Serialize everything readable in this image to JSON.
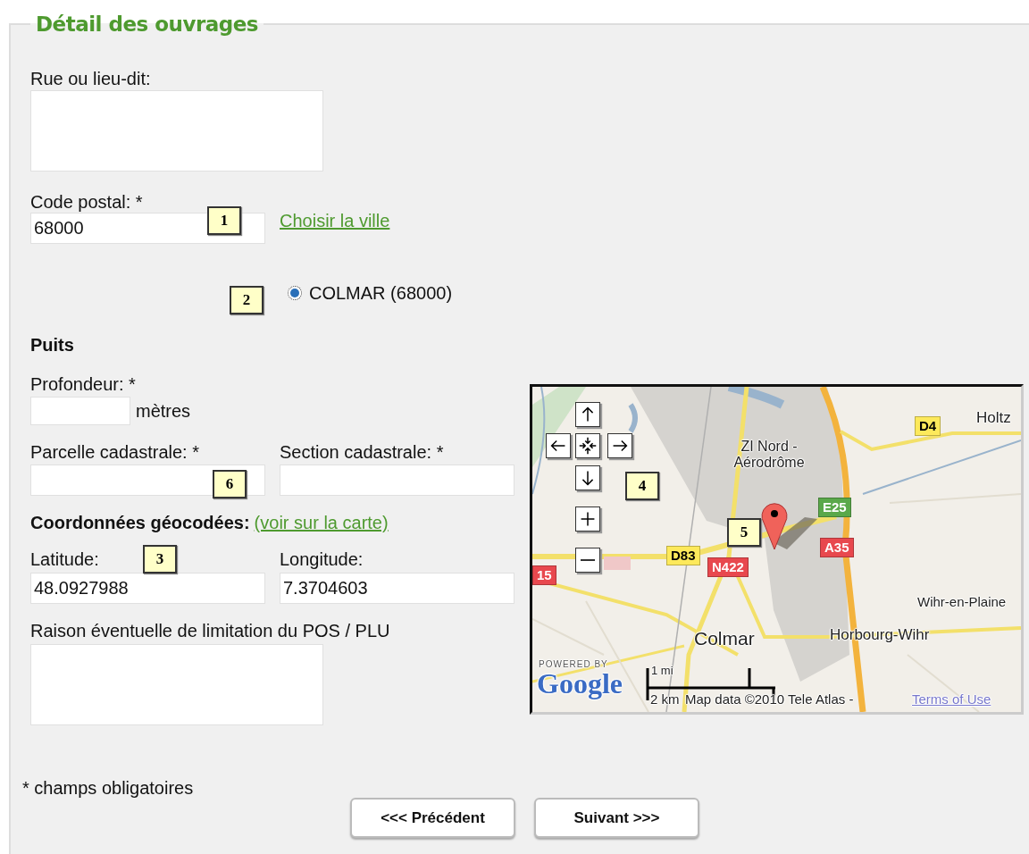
{
  "section": {
    "title": "Détail des ouvrages"
  },
  "street": {
    "label": "Rue ou lieu-dit:"
  },
  "postal": {
    "label": "Code postal: *",
    "value": "68000",
    "link": "Choisir la ville"
  },
  "cities": [
    {
      "label": "COLMAR (68000)",
      "selected": true
    }
  ],
  "well": {
    "heading": "Puits",
    "depth_label": "Profondeur: *",
    "depth_unit": "mètres",
    "parcel_label": "Parcelle cadastrale: *",
    "section_label": "Section cadastrale: *"
  },
  "coordinates": {
    "heading": "Coordonnées géocodées:",
    "link": "(voir sur la carte)",
    "latitude_label": "Latitude:",
    "latitude": "48.0927988",
    "longitude_label": "Longitude:",
    "longitude": "7.3704603"
  },
  "limitation": {
    "label": "Raison éventuelle de limitation du POS / PLU"
  },
  "map": {
    "places": [
      "Holtz",
      "ZI Nord -Aérodrôme",
      "Wihr-en-Plaine",
      "Colmar",
      "Horbourg-Wihr"
    ],
    "roads": [
      {
        "label": "D4",
        "color": "#fde95b"
      },
      {
        "label": "E25",
        "color": "#5aa84a"
      },
      {
        "label": "A35",
        "color": "#e8484e"
      },
      {
        "label": "D83",
        "color": "#fde95b"
      },
      {
        "label": "N422",
        "color": "#e8484e"
      },
      {
        "label": "15",
        "color": "#e8484e"
      }
    ],
    "powered_by": "POWERED BY",
    "logo": "Google",
    "scale_top": "1 mi",
    "scale_bottom": "2 km",
    "attribution": "Map data ©2010 Tele Atlas -",
    "terms": "Terms of Use"
  },
  "callouts": [
    "1",
    "2",
    "6",
    "3",
    "4",
    "5"
  ],
  "required_note": "* champs obligatoires",
  "buttons": [
    "<<< Précédent",
    "Suivant >>>"
  ]
}
